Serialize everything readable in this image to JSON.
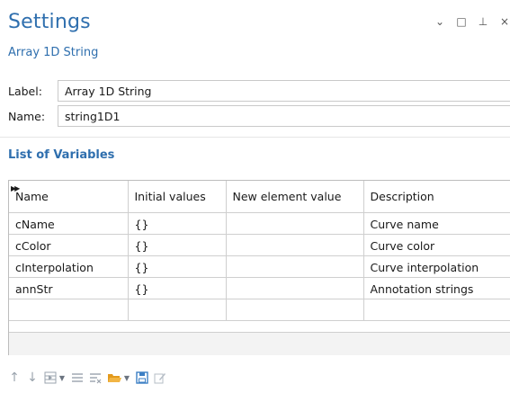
{
  "panel": {
    "title": "Settings",
    "subtitle": "Array 1D String",
    "controls": [
      {
        "name": "dropdown",
        "glyph": "⌄"
      },
      {
        "name": "maximize",
        "glyph": "□"
      },
      {
        "name": "pin",
        "glyph": "⊥"
      },
      {
        "name": "close",
        "glyph": "×"
      }
    ]
  },
  "fields": {
    "label": {
      "caption": "Label:",
      "value": "Array 1D String"
    },
    "name": {
      "caption": "Name:",
      "value": "string1D1"
    }
  },
  "section": {
    "title": "List of Variables"
  },
  "table": {
    "columns": [
      "Name",
      "Initial values",
      "New element value",
      "Description"
    ],
    "rows": [
      [
        "cName",
        "{}",
        "",
        "Curve name"
      ],
      [
        "cColor",
        "{}",
        "",
        "Curve color"
      ],
      [
        "cInterpolation",
        "{}",
        "",
        "Curve interpolation"
      ],
      [
        "annStr",
        "{}",
        "",
        "Annotation strings"
      ],
      [
        "",
        "",
        "",
        ""
      ]
    ]
  },
  "toolbar": {
    "icons": [
      "move-up-icon",
      "move-down-icon",
      "add-row-icon",
      "dropdown-arrow-icon",
      "list-icon",
      "clear-list-icon",
      "open-folder-icon",
      "dropdown-arrow-icon",
      "save-icon",
      "edit-icon"
    ]
  },
  "colors": {
    "accent": "#2f6fae",
    "folder": "#e39a1c",
    "save": "#3c7fc4"
  }
}
